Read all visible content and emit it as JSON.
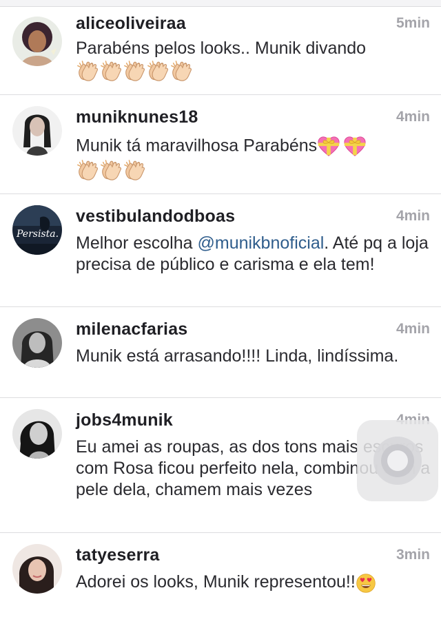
{
  "comments": [
    {
      "username": "aliceoliveiraa",
      "time": "5min",
      "text": "Parabéns pelos looks.. Munik divando",
      "emoji": "clapping-hands x5"
    },
    {
      "username": "muniknunes18",
      "time": "4min",
      "text": "Munik tá maravilhosa Parabéns",
      "emoji": "heart-with-ribbon x2, clapping-hands x3"
    },
    {
      "username": "vestibulandodboas",
      "time": "4min",
      "text_before": "Melhor escolha ",
      "mention": "@munikbnoficial",
      "text_after": ". Até pq a loja precisa de público e carisma e ela tem!",
      "avatar_text": "Persista."
    },
    {
      "username": "milenacfarias",
      "time": "4min",
      "text": "Munik está arrasando!!!! Linda, lindíssima."
    },
    {
      "username": "jobs4munik",
      "time": "4min",
      "text": "Eu amei as roupas, as dos tons mais escuros com Rosa ficou perfeito nela, combinou com a pele dela, chamem mais vezes"
    },
    {
      "username": "tatyeserra",
      "time": "3min",
      "text": "Adorei os looks, Munik representou!!",
      "emoji": "heart-eyes"
    }
  ],
  "colors": {
    "username": "#1f1f24",
    "time": "#a4a4aa",
    "text": "#2a2a2f",
    "mention": "#2f5d8c",
    "divider": "#dcdcdf"
  }
}
